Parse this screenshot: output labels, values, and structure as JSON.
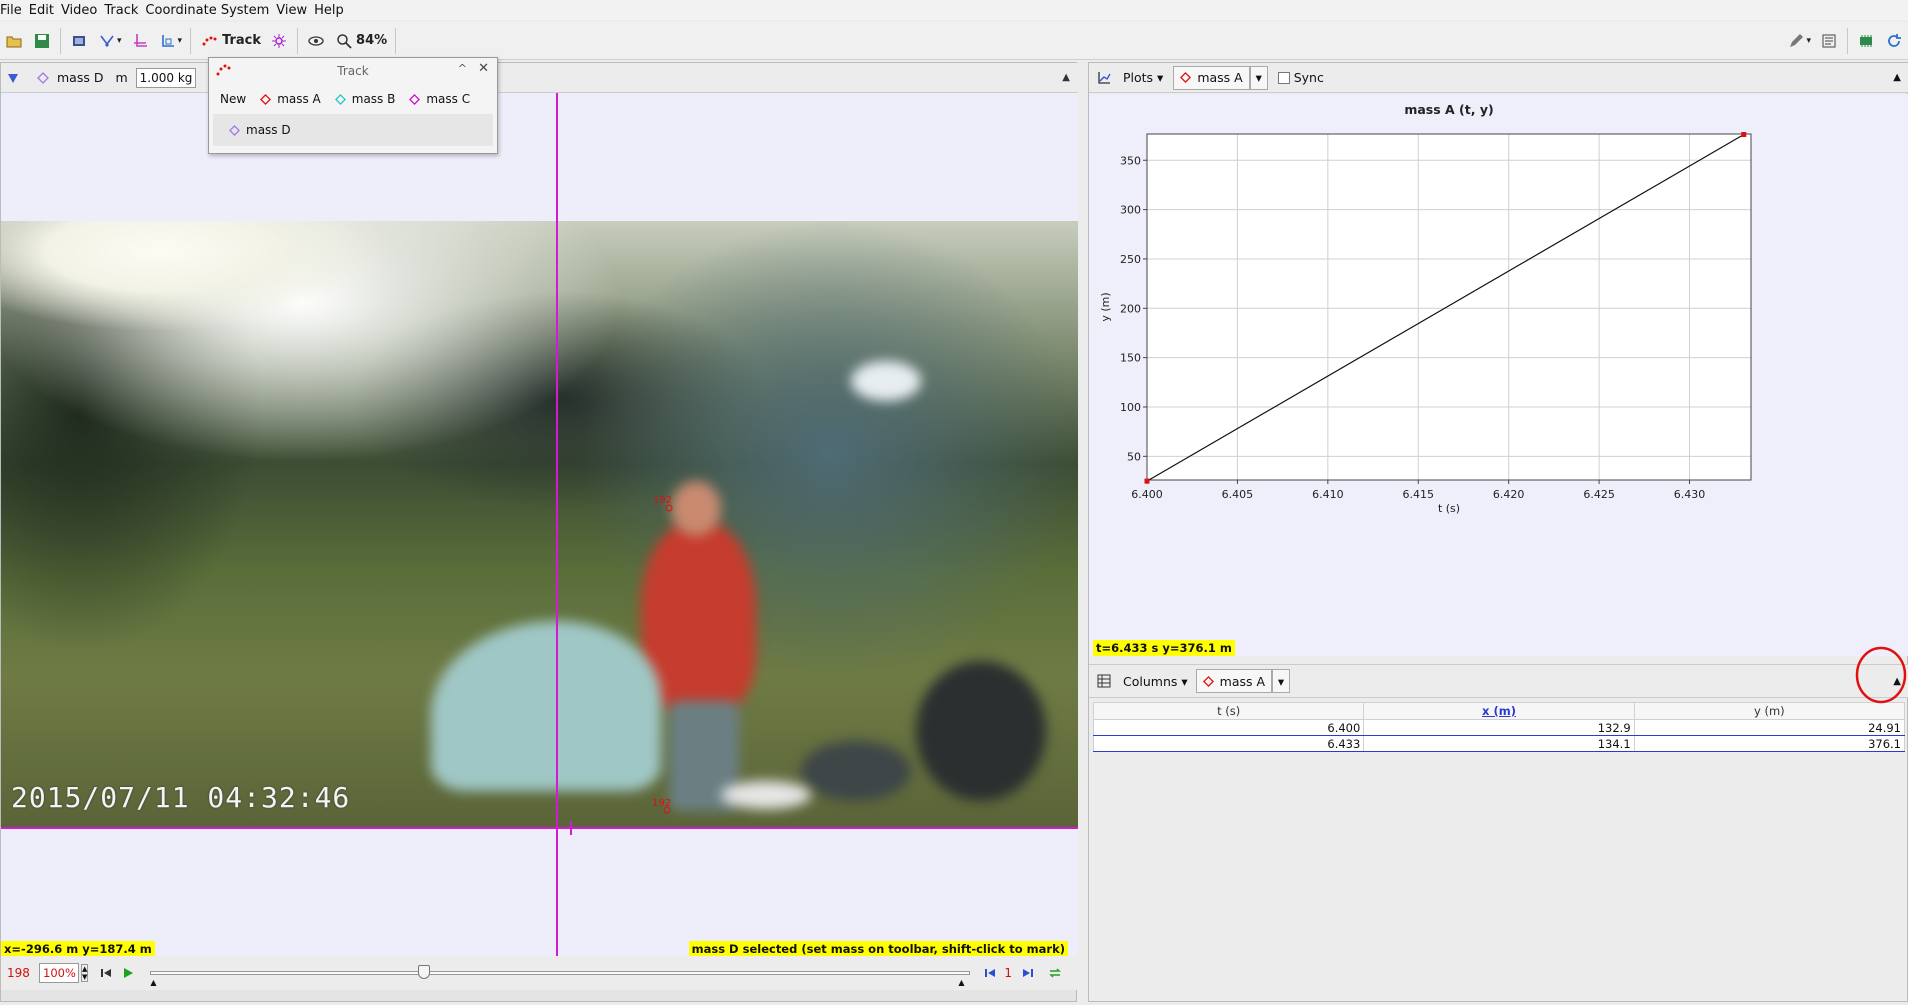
{
  "menu": [
    "File",
    "Edit",
    "Video",
    "Track",
    "Coordinate System",
    "View",
    "Help"
  ],
  "toolbar": {
    "track_label": "Track",
    "zoom_label": "84%"
  },
  "trackbar": {
    "track_name": "mass D",
    "mass_label": "m",
    "mass_value": "1.000 kg"
  },
  "track_popup": {
    "title": "Track",
    "new_label": "New",
    "items": [
      {
        "name": "mass A",
        "color": "#e01010"
      },
      {
        "name": "mass B",
        "color": "#22c8c8"
      },
      {
        "name": "mass C",
        "color": "#d010d0"
      },
      {
        "name": "mass D",
        "color": "#a078e8"
      }
    ]
  },
  "video": {
    "timestamp": "2015/07/11  04:32:46",
    "marker_top_label": "192",
    "marker_bottom_label": "192",
    "hud_left": "x=-296.6 m  y=187.4 m",
    "hud_right": "mass D selected (set mass on toolbar, shift-click to mark)"
  },
  "player": {
    "frame": "198",
    "rate": "100%",
    "step": "1"
  },
  "plot_toolbar": {
    "plots_label": "Plots",
    "track_label": "mass A",
    "sync_label": "Sync"
  },
  "chart_data": {
    "type": "line",
    "title": "mass A (t, y)",
    "xlabel": "t (s)",
    "ylabel": "y (m)",
    "x": [
      6.4,
      6.433
    ],
    "series": [
      {
        "values": [
          24.91,
          376.1
        ]
      }
    ],
    "xlim": [
      6.4,
      6.4334
    ],
    "ylim": [
      26,
      376.6
    ],
    "xticks": [
      6.4,
      6.405,
      6.41,
      6.415,
      6.42,
      6.425,
      6.43
    ],
    "xtick_labels": [
      "6.400",
      "6.405",
      "6.410",
      "6.415",
      "6.420",
      "6.425",
      "6.430"
    ],
    "yticks": [
      50,
      100,
      150,
      200,
      250,
      300,
      350
    ],
    "grid": true,
    "readout": "t=6.433 s  y=376.1 m"
  },
  "table_toolbar": {
    "columns_label": "Columns",
    "track_label": "mass A"
  },
  "table": {
    "headers": [
      "t (s)",
      "x (m)",
      "y (m)"
    ],
    "rows": [
      [
        "6.400",
        "132.9",
        "24.91"
      ],
      [
        "6.433",
        "134.1",
        "376.1"
      ]
    ]
  }
}
